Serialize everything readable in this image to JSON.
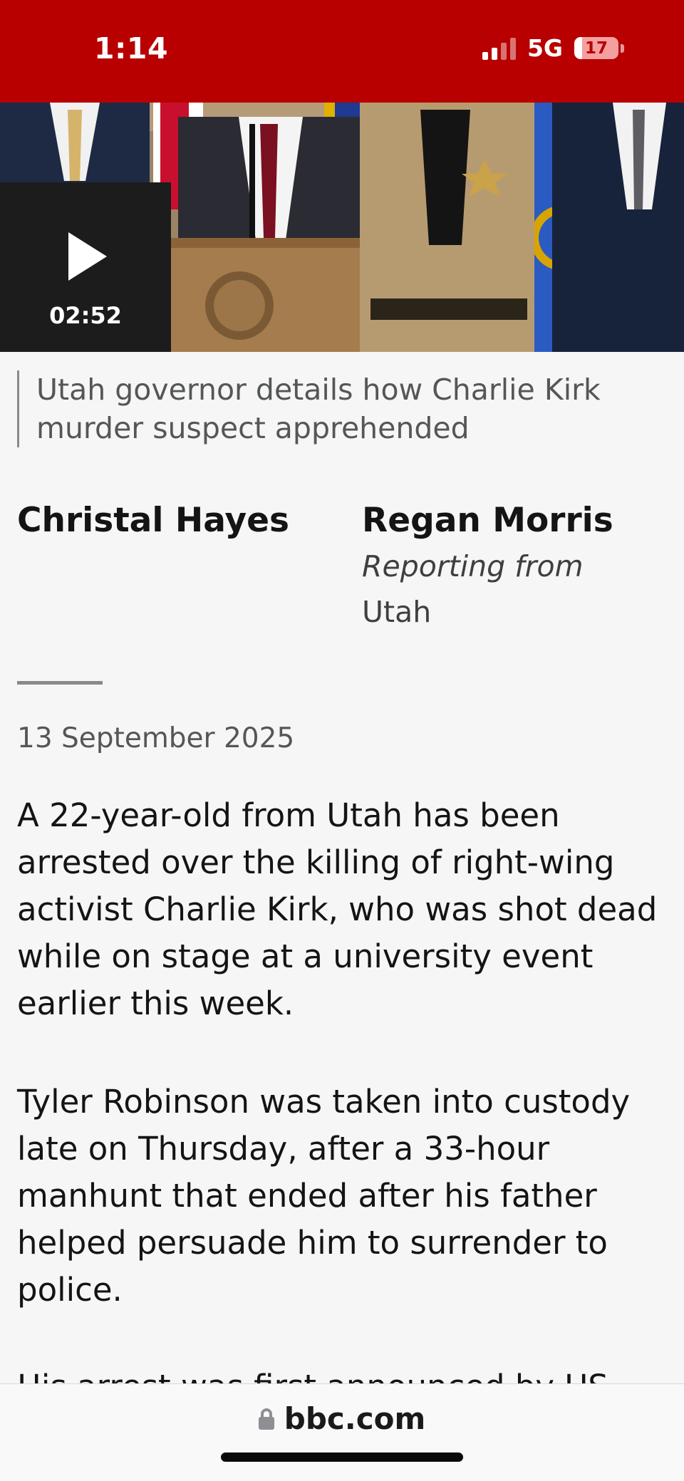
{
  "status_bar": {
    "time": "1:14",
    "network": "5G",
    "battery_level": "17",
    "battery_fraction": 0.17,
    "signal_bars_active": 2,
    "signal_bars_total": 4
  },
  "colors": {
    "brand_red": "#b80000",
    "background": "#f6f6f6",
    "text": "#141414",
    "muted_text": "#545658"
  },
  "video": {
    "play_icon": "play-icon",
    "duration": "02:52"
  },
  "caption": "Utah governor details how Charlie Kirk murder suspect apprehended",
  "bylines": [
    {
      "name": "Christal Hayes"
    },
    {
      "name": "Regan Morris",
      "role": "Reporting from",
      "location": "Utah"
    }
  ],
  "date": "13 September 2025",
  "paragraphs": [
    "A 22-year-old from Utah has been arrested over the killing of right-wing activist Charlie Kirk, who was shot dead while on stage at a university event earlier this week.",
    "Tyler Robinson was taken into custody late on Thursday, after a 33-hour manhunt that ended after his father helped persuade him to surrender to police.",
    "His arrest was first announced by US"
  ],
  "url_bar": {
    "icon": "lock-icon",
    "domain": "bbc.com"
  }
}
